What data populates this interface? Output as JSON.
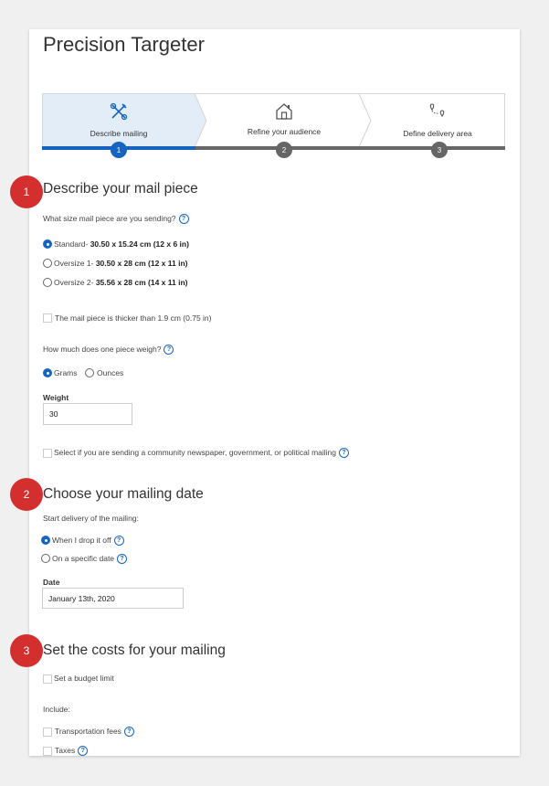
{
  "page": {
    "title": "Precision Targeter"
  },
  "steps": [
    {
      "label": "Describe mailing",
      "number": "1",
      "icon": "tools-icon"
    },
    {
      "label": "Refine your audience",
      "number": "2",
      "icon": "house-icon"
    },
    {
      "label": "Define delivery area",
      "number": "3",
      "icon": "route-icon"
    }
  ],
  "colors": {
    "accent": "#1565c0",
    "active_step_bg": "#e3edf8",
    "badge": "#d32f2f",
    "inactive": "#666666"
  },
  "section1": {
    "badge": "1",
    "heading": "Describe your mail piece",
    "question": "What size mail piece are you sending?",
    "sizes": [
      {
        "prefix": "Standard- ",
        "dims": "30.50 x 15.24 cm (12 x 6 in)",
        "selected": true
      },
      {
        "prefix": "Oversize 1- ",
        "dims": "30.50 x 28 cm (12 x 11 in)",
        "selected": false
      },
      {
        "prefix": "Oversize 2- ",
        "dims": "35.56 x 28 cm (14 x 11 in)",
        "selected": false
      }
    ],
    "thick_label": "The mail piece is thicker than 1.9 cm (0.75 in)",
    "weigh_question": "How much does one piece weigh?",
    "unit_grams": "Grams",
    "unit_ounces": "Ounces",
    "weight_label": "Weight",
    "weight_value": "30",
    "community_label": "Select if you are sending a community newspaper, government, or political mailing"
  },
  "section2": {
    "badge": "2",
    "heading": "Choose your mailing date",
    "start_label": "Start delivery of the mailing:",
    "opt_drop": "When I drop it off",
    "opt_specific": "On a specific date",
    "date_label": "Date",
    "date_value": "January 13th, 2020"
  },
  "section3": {
    "badge": "3",
    "heading": "Set the costs for your mailing",
    "budget_label": "Set a budget limit",
    "include_label": "Include:",
    "transport_label": "Transportation fees",
    "taxes_label": "Taxes"
  }
}
